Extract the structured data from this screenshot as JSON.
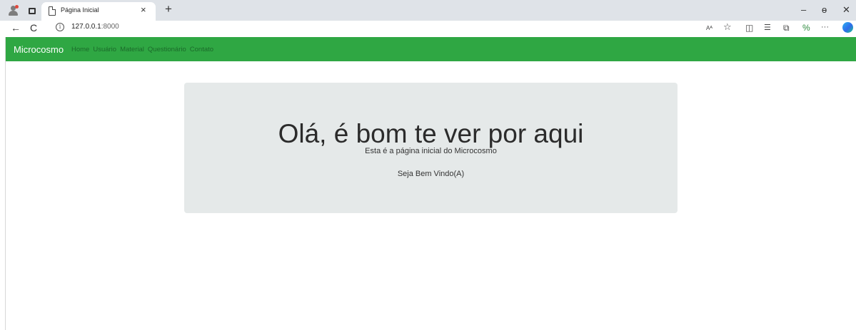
{
  "browser": {
    "tab": {
      "title": "Página Inicial",
      "close": "×"
    },
    "new_tab": "+",
    "window": {
      "minimize": "–",
      "restore": "ɵ",
      "close": "✕"
    },
    "nav": {
      "back": "←",
      "refresh": "C"
    },
    "address": {
      "host": "127.0.0.1",
      "port": ":8000",
      "info": "i"
    },
    "toolbar_icons": [
      {
        "icon": "read-aloud-icon",
        "glyph": "Aᴬ"
      },
      {
        "icon": "favorite-star-icon",
        "glyph": "☆"
      },
      {
        "icon": "split-screen-icon",
        "glyph": "◫"
      },
      {
        "icon": "favorites-list-icon",
        "glyph": "☰"
      },
      {
        "icon": "collections-icon",
        "glyph": "⧉"
      },
      {
        "icon": "extensions-icon",
        "glyph": "%"
      },
      {
        "icon": "more-icon",
        "glyph": "···"
      }
    ]
  },
  "navbar": {
    "brand": "Microcosmo",
    "links": [
      "Home",
      "Usuário",
      "Material",
      "Questionário",
      "Contato"
    ]
  },
  "hero": {
    "title": "Olá, é bom te ver por aqui",
    "lead": "Esta é a página inicial do Microcosmo",
    "welcome": "Seja Bem Vindo(A)"
  },
  "colors": {
    "navbar_bg": "#2fa743",
    "navlink": "#1b6a2a",
    "jumbotron_bg": "#e5e9e9"
  }
}
